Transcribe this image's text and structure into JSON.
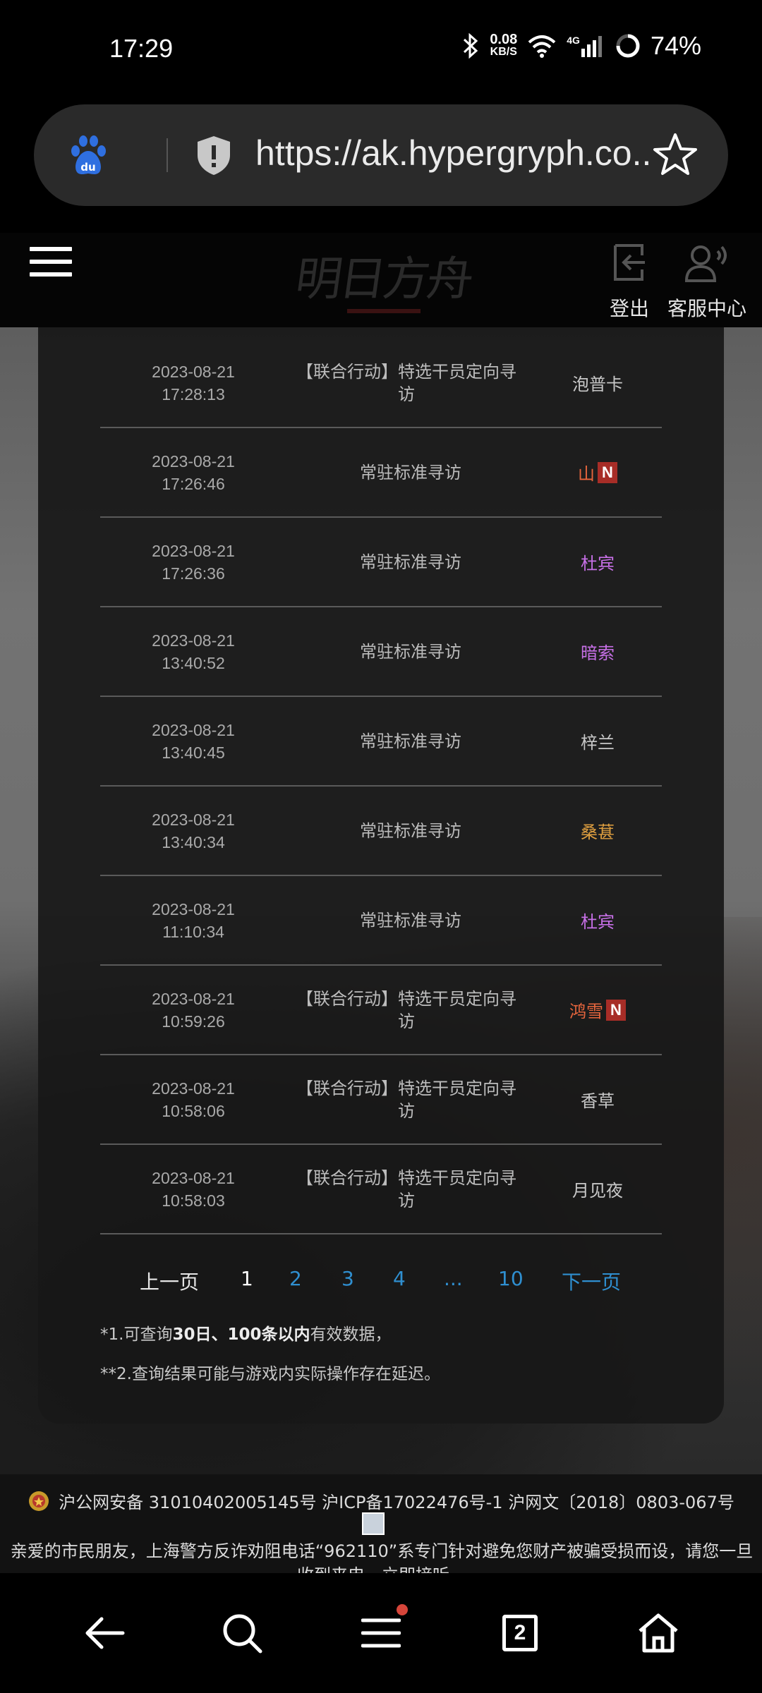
{
  "status_bar": {
    "time": "17:29",
    "speed_value": "0.08",
    "speed_unit": "KB/S",
    "network": "4G",
    "battery": "74%"
  },
  "url_bar": {
    "url": "https://ak.hypergryph.co...",
    "icons": [
      "baidu-icon",
      "shield-icon",
      "star-icon"
    ]
  },
  "header": {
    "logo_text": "明日方舟",
    "logout_label": "登出",
    "service_label": "客服中心"
  },
  "records": [
    {
      "date": "2023-08-21",
      "time": "17:28:13",
      "pool_bracket": "【联合行动】",
      "pool_text": "特选干员定向寻访",
      "operator": "泡普卡",
      "color": "#c8c8c8",
      "new": false
    },
    {
      "date": "2023-08-21",
      "time": "17:26:46",
      "pool_bracket": "",
      "pool_text": "常驻标准寻访",
      "operator": "山",
      "color": "#e8663d",
      "new": true
    },
    {
      "date": "2023-08-21",
      "time": "17:26:36",
      "pool_bracket": "",
      "pool_text": "常驻标准寻访",
      "operator": "杜宾",
      "color": "#c870e8",
      "new": false
    },
    {
      "date": "2023-08-21",
      "time": "13:40:52",
      "pool_bracket": "",
      "pool_text": "常驻标准寻访",
      "operator": "暗索",
      "color": "#c870e8",
      "new": false
    },
    {
      "date": "2023-08-21",
      "time": "13:40:45",
      "pool_bracket": "",
      "pool_text": "常驻标准寻访",
      "operator": "梓兰",
      "color": "#c8c8c8",
      "new": false
    },
    {
      "date": "2023-08-21",
      "time": "13:40:34",
      "pool_bracket": "",
      "pool_text": "常驻标准寻访",
      "operator": "桑葚",
      "color": "#e0a040",
      "new": false
    },
    {
      "date": "2023-08-21",
      "time": "11:10:34",
      "pool_bracket": "",
      "pool_text": "常驻标准寻访",
      "operator": "杜宾",
      "color": "#c870e8",
      "new": false
    },
    {
      "date": "2023-08-21",
      "time": "10:59:26",
      "pool_bracket": "【联合行动】",
      "pool_text": "特选干员定向寻访",
      "operator": "鸿雪",
      "color": "#e8663d",
      "new": true
    },
    {
      "date": "2023-08-21",
      "time": "10:58:06",
      "pool_bracket": "【联合行动】",
      "pool_text": "特选干员定向寻访",
      "operator": "香草",
      "color": "#c8c8c8",
      "new": false
    },
    {
      "date": "2023-08-21",
      "time": "10:58:03",
      "pool_bracket": "【联合行动】",
      "pool_text": "特选干员定向寻访",
      "operator": "月见夜",
      "color": "#c8c8c8",
      "new": false
    }
  ],
  "new_badge": "N",
  "pagination": {
    "prev": "上一页",
    "pages": [
      "1",
      "2",
      "3",
      "4",
      "...",
      "10"
    ],
    "current": "1",
    "next": "下一页",
    "active_color": "#ffffff",
    "link_color": "#2f8fd0"
  },
  "notes": {
    "note1_prefix": "*1.可查询",
    "note1_bold": "30日、100条以内",
    "note1_suffix": "有效数据，",
    "note2": "**2.查询结果可能与游戏内实际操作存在延迟。"
  },
  "footer": {
    "line1": "沪公网安备 31010402005145号  沪ICP备17022476号-1  沪网文〔2018〕0803-067号",
    "line2": "亲爱的市民朋友，上海警方反诈劝阻电话“962110”系专门针对避免您财产被骗受损而设，请您一旦收到来电，立即接听。"
  },
  "bottom_nav": {
    "tab_count": "2"
  }
}
